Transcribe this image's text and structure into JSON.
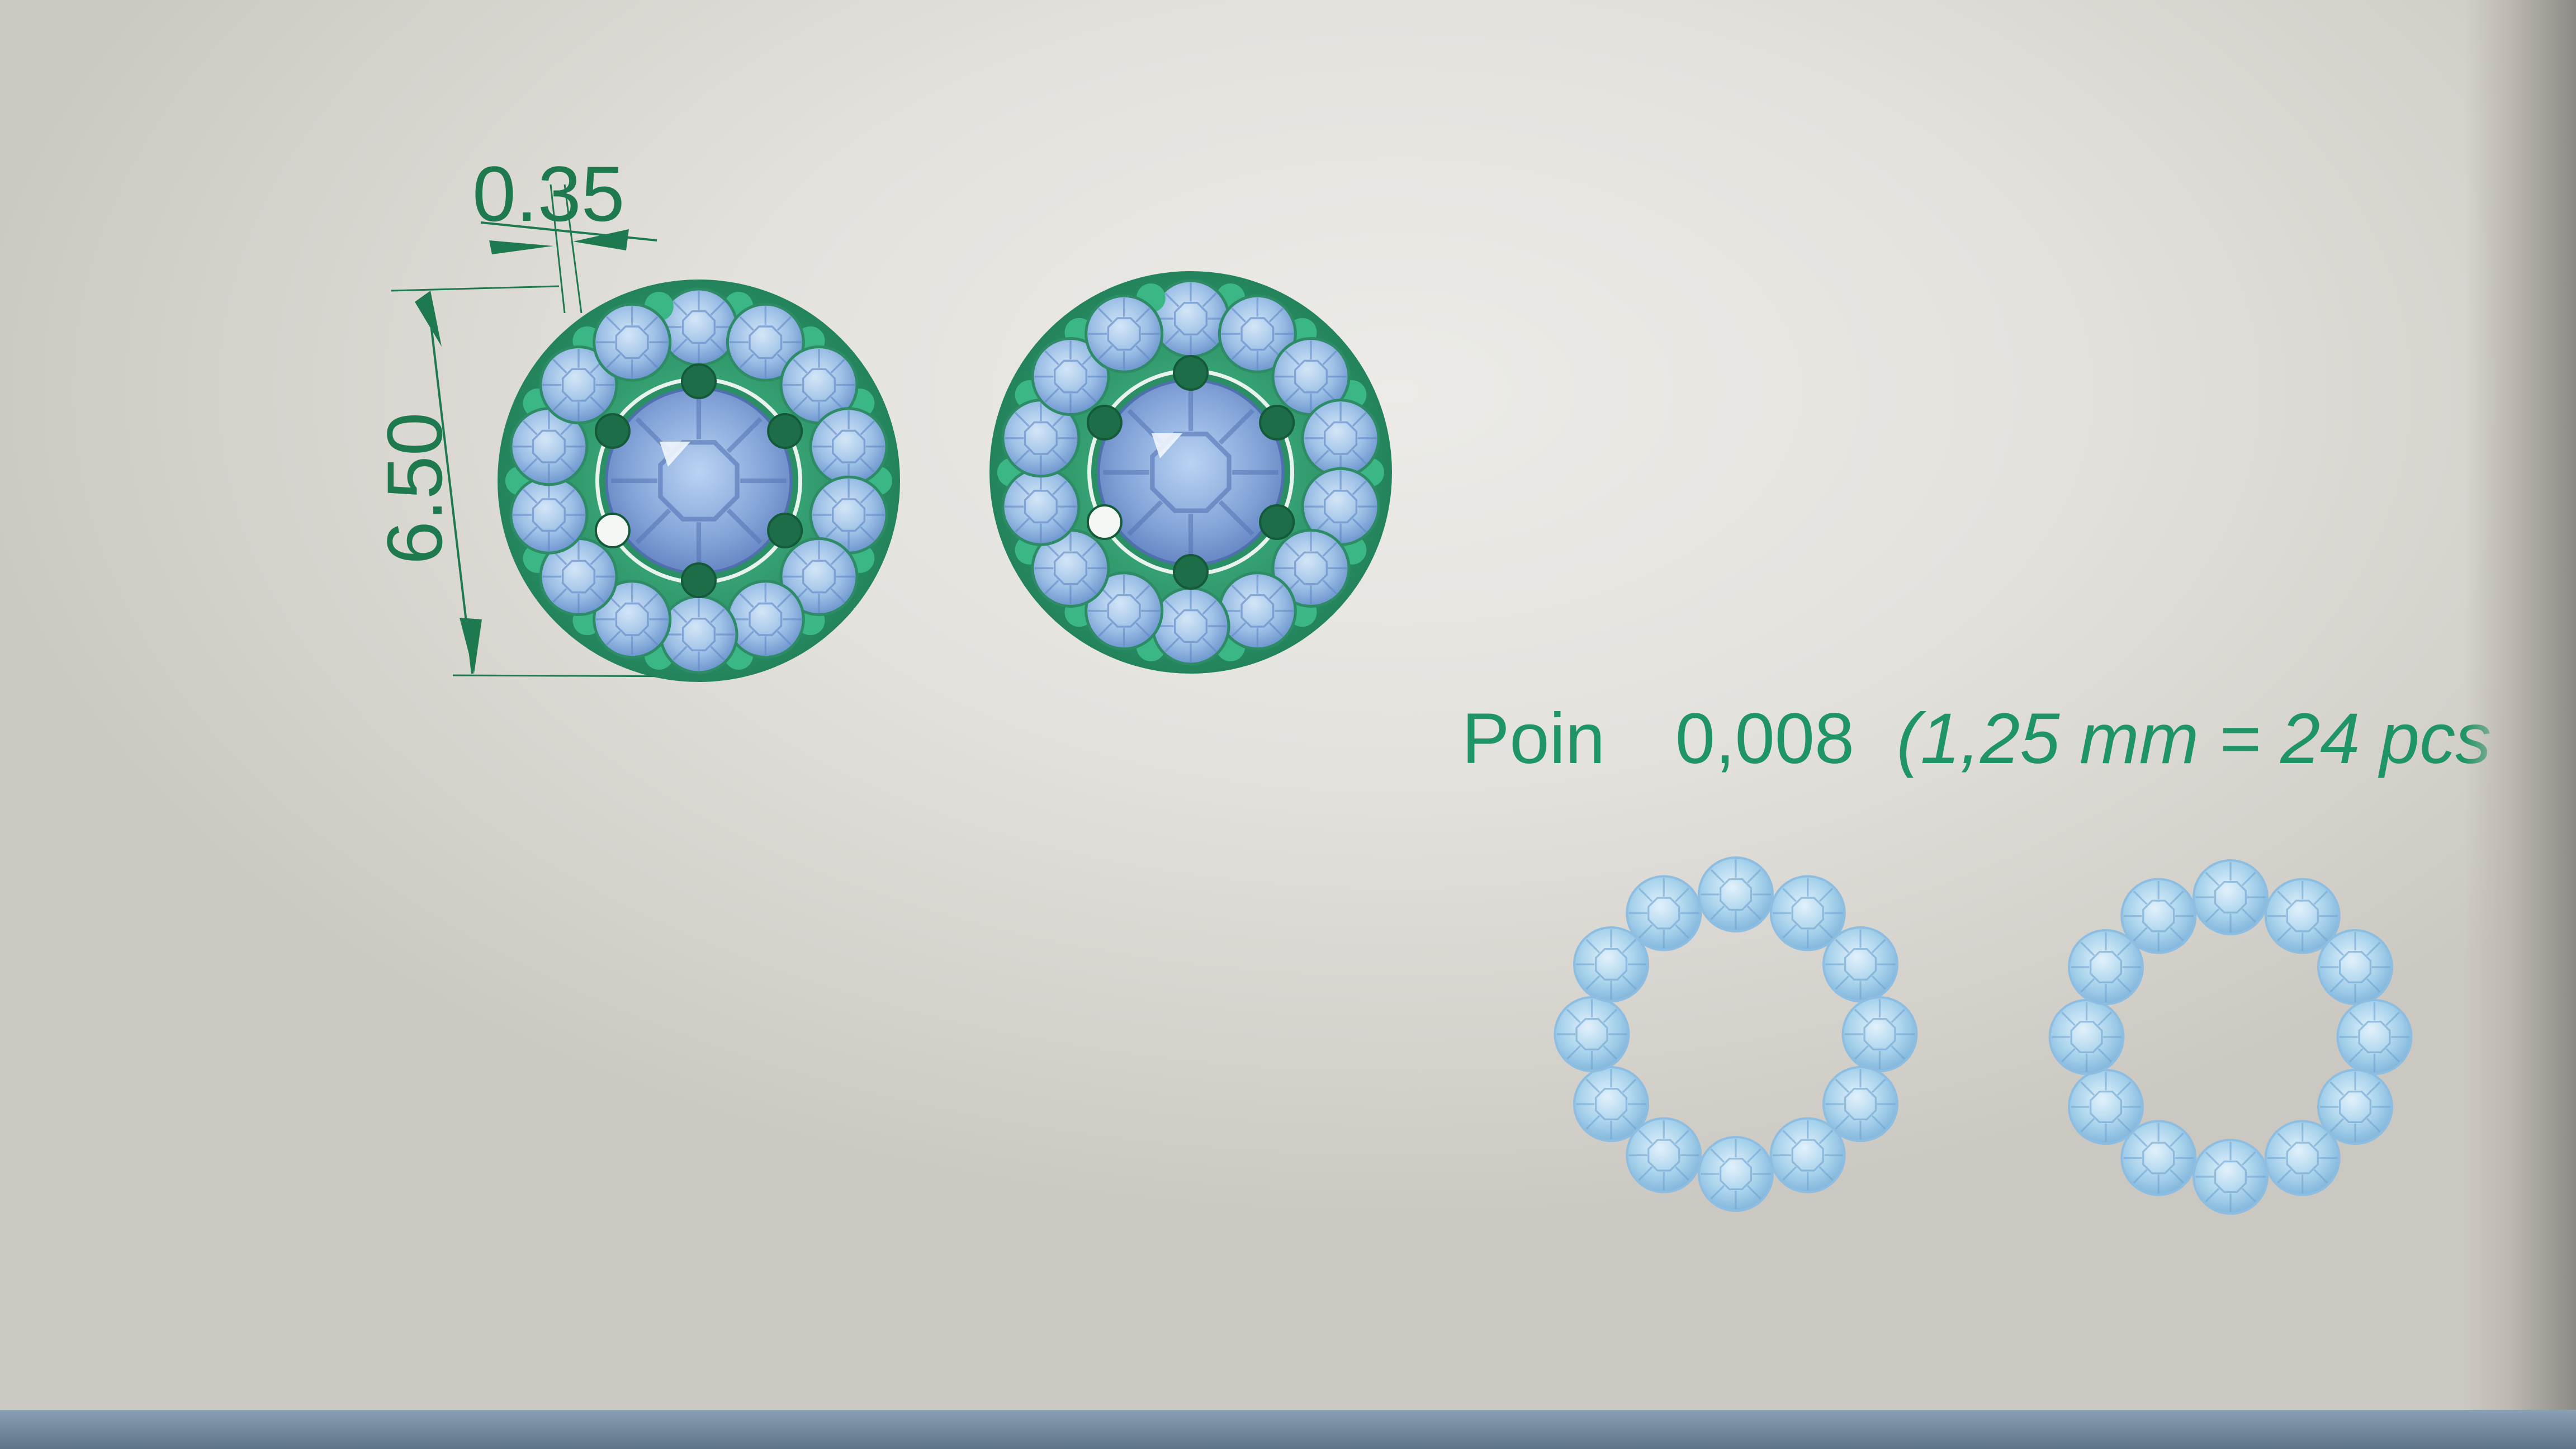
{
  "drawing": {
    "dimension_width": "0.35",
    "dimension_height": "6.50",
    "caption_prefix": "Poin",
    "caption_value": "0,008",
    "caption_detail": "(1,25 mm = 24 pcs"
  },
  "colors": {
    "dimension": "#1e7a4e",
    "caption": "#1f9466",
    "setting_metal": "#2f9e70",
    "center_stone": "#7f9fd4",
    "halo_stone": "#9fc2e6",
    "loose_stone": "#a8d2ea"
  },
  "icons": [
    "halo-earring-left",
    "halo-earring-right",
    "stone-ring-left",
    "stone-ring-right"
  ]
}
